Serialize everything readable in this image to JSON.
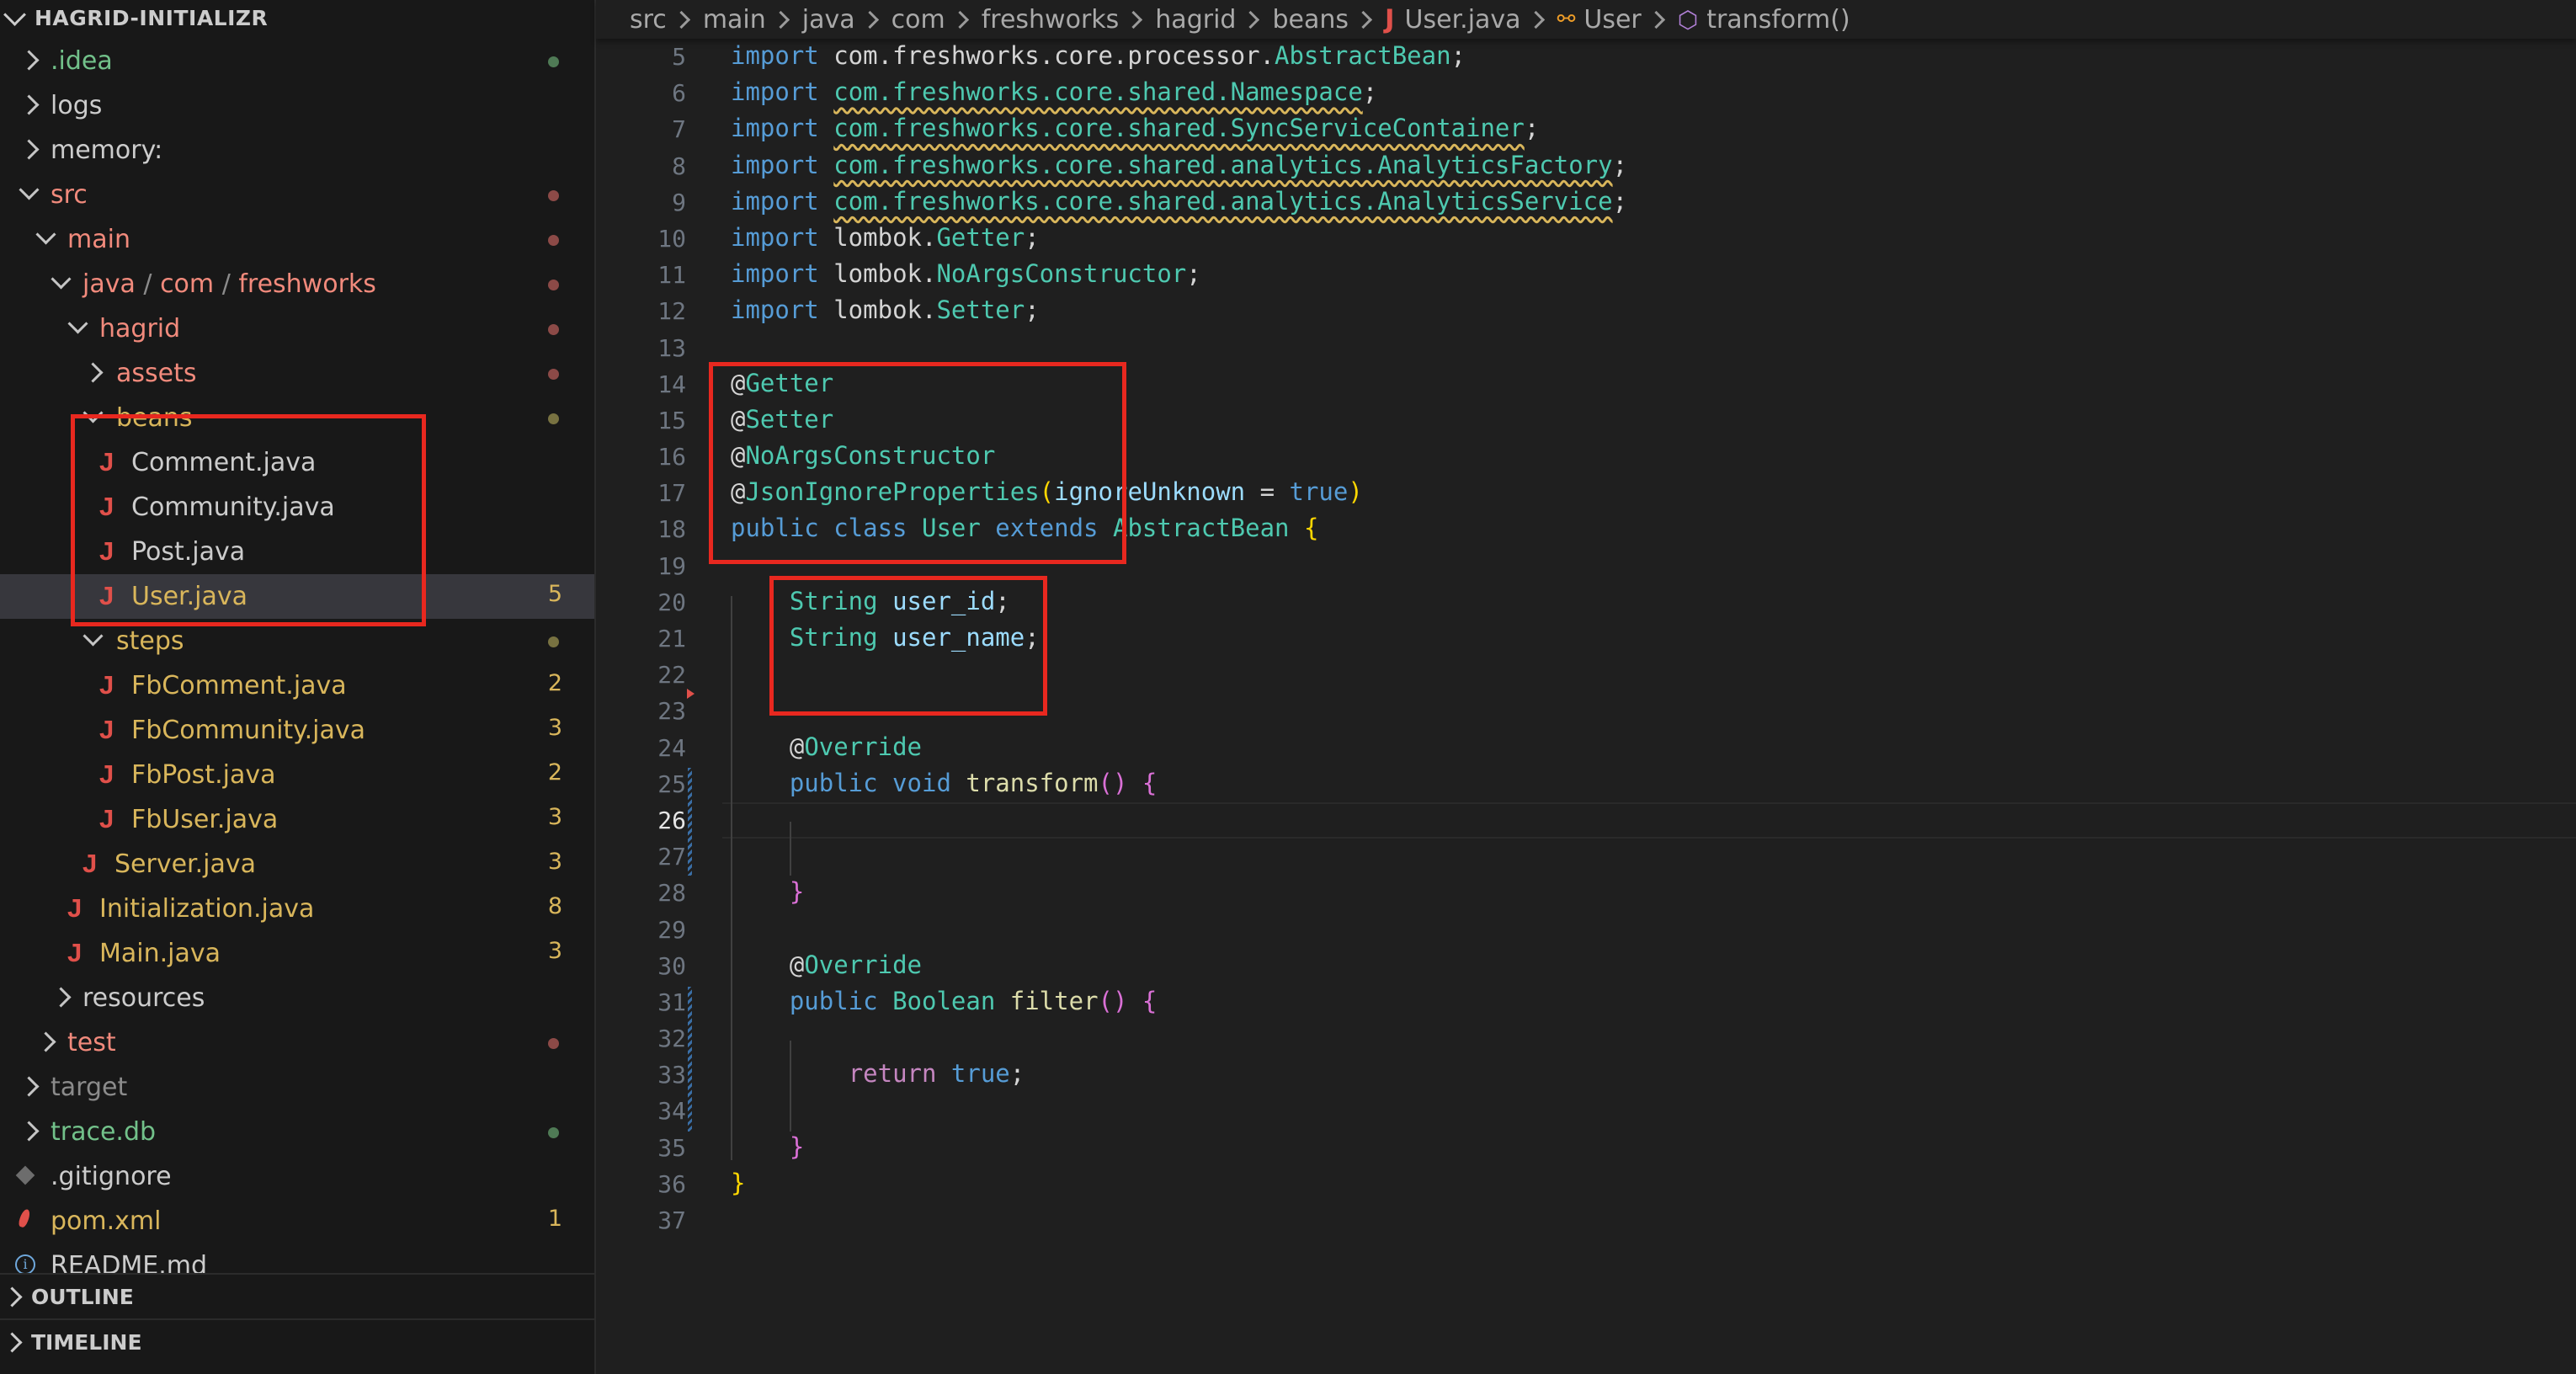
{
  "explorer": {
    "title": "HAGRID-INITIALIZR",
    "rows": [
      {
        "label": ".idea",
        "decor": "dot-green"
      },
      {
        "label": "logs"
      },
      {
        "label": "memory:"
      },
      {
        "label": "src",
        "decor": "dot-red"
      },
      {
        "label": "main",
        "decor": "dot-red"
      },
      {
        "label": "java",
        "label2": "com",
        "label3": "freshworks",
        "decor": "dot-red"
      },
      {
        "label": "hagrid",
        "decor": "dot-red"
      },
      {
        "label": "assets",
        "decor": "dot-red"
      },
      {
        "label": "beans",
        "decor": "dot-yellow"
      },
      {
        "label": "Comment.java"
      },
      {
        "label": "Community.java"
      },
      {
        "label": "Post.java"
      },
      {
        "label": "User.java",
        "count": "5"
      },
      {
        "label": "steps",
        "decor": "dot-yellow"
      },
      {
        "label": "FbComment.java",
        "count": "2"
      },
      {
        "label": "FbCommunity.java",
        "count": "3"
      },
      {
        "label": "FbPost.java",
        "count": "2"
      },
      {
        "label": "FbUser.java",
        "count": "3"
      },
      {
        "label": "Server.java",
        "count": "3"
      },
      {
        "label": "Initialization.java",
        "count": "8"
      },
      {
        "label": "Main.java",
        "count": "3"
      },
      {
        "label": "resources"
      },
      {
        "label": "test",
        "decor": "dot-red"
      },
      {
        "label": "target"
      },
      {
        "label": "trace.db",
        "decor": "dot-green"
      },
      {
        "label": ".gitignore"
      },
      {
        "label": "pom.xml",
        "count": "1"
      },
      {
        "label": "README.md"
      }
    ],
    "path_separator": "/",
    "colors": {
      "modified": "#d9b65b",
      "error": "#f18a7c",
      "untracked": "#72c18a",
      "ignored": "#8b8b8b",
      "java_icon": "#e0504a",
      "dot_red": "#8c4a47",
      "dot_green": "#4f7a55",
      "dot_yellow": "#787241"
    }
  },
  "panels": {
    "outline": "OUTLINE",
    "timeline": "TIMELINE"
  },
  "breadcrumb": {
    "items": [
      "src",
      "main",
      "java",
      "com",
      "freshworks",
      "hagrid",
      "beans",
      "User.java",
      "User",
      "transform()"
    ]
  },
  "editor": {
    "lines": [
      {
        "n": "5",
        "t": [
          [
            "kw",
            "import"
          ],
          [
            "pl",
            " com.freshworks.core.processor."
          ],
          [
            "ty",
            "AbstractBean"
          ],
          [
            "pl",
            ";"
          ]
        ]
      },
      {
        "n": "6",
        "t": [
          [
            "kw",
            "import"
          ],
          [
            "pl",
            " "
          ],
          [
            "ty sq",
            "com.freshworks.core.shared.Namespace"
          ],
          [
            "pl",
            ";"
          ]
        ]
      },
      {
        "n": "7",
        "t": [
          [
            "kw",
            "import"
          ],
          [
            "pl",
            " "
          ],
          [
            "ty sq",
            "com.freshworks.core.shared.SyncServiceContainer"
          ],
          [
            "pl",
            ";"
          ]
        ]
      },
      {
        "n": "8",
        "t": [
          [
            "kw",
            "import"
          ],
          [
            "pl",
            " "
          ],
          [
            "ty sq",
            "com.freshworks.core.shared.analytics.AnalyticsFactory"
          ],
          [
            "pl",
            ";"
          ]
        ]
      },
      {
        "n": "9",
        "t": [
          [
            "kw",
            "import"
          ],
          [
            "pl",
            " "
          ],
          [
            "ty sq",
            "com.freshworks.core.shared.analytics.AnalyticsService"
          ],
          [
            "pl",
            ";"
          ]
        ]
      },
      {
        "n": "10",
        "t": [
          [
            "kw",
            "import"
          ],
          [
            "pl",
            " lombok."
          ],
          [
            "ty",
            "Getter"
          ],
          [
            "pl",
            ";"
          ]
        ]
      },
      {
        "n": "11",
        "t": [
          [
            "kw",
            "import"
          ],
          [
            "pl",
            " lombok."
          ],
          [
            "ty",
            "NoArgsConstructor"
          ],
          [
            "pl",
            ";"
          ]
        ]
      },
      {
        "n": "12",
        "t": [
          [
            "kw",
            "import"
          ],
          [
            "pl",
            " lombok."
          ],
          [
            "ty",
            "Setter"
          ],
          [
            "pl",
            ";"
          ]
        ]
      },
      {
        "n": "13",
        "t": []
      },
      {
        "n": "14",
        "t": [
          [
            "pl",
            "@"
          ],
          [
            "ty",
            "Getter"
          ]
        ]
      },
      {
        "n": "15",
        "t": [
          [
            "pl",
            "@"
          ],
          [
            "ty",
            "Setter"
          ]
        ]
      },
      {
        "n": "16",
        "t": [
          [
            "pl",
            "@"
          ],
          [
            "ty",
            "NoArgsConstructor"
          ]
        ]
      },
      {
        "n": "17",
        "t": [
          [
            "pl",
            "@"
          ],
          [
            "ty",
            "JsonIgnoreProperties"
          ],
          [
            "br1",
            "("
          ],
          [
            "vr",
            "ignoreUnknown"
          ],
          [
            "pl",
            " = "
          ],
          [
            "kw",
            "true"
          ],
          [
            "br1",
            ")"
          ]
        ]
      },
      {
        "n": "18",
        "t": [
          [
            "kw",
            "public class"
          ],
          [
            "pl",
            " "
          ],
          [
            "ty",
            "User"
          ],
          [
            "pl",
            " "
          ],
          [
            "kw",
            "extends"
          ],
          [
            "pl",
            " "
          ],
          [
            "ty",
            "AbstractBean"
          ],
          [
            "pl",
            " "
          ],
          [
            "br1",
            "{"
          ]
        ]
      },
      {
        "n": "19",
        "t": []
      },
      {
        "n": "20",
        "t": [
          [
            "pl",
            "    "
          ],
          [
            "ty",
            "String"
          ],
          [
            "pl",
            " "
          ],
          [
            "vr",
            "user_id"
          ],
          [
            "pl",
            ";"
          ]
        ]
      },
      {
        "n": "21",
        "t": [
          [
            "pl",
            "    "
          ],
          [
            "ty",
            "String"
          ],
          [
            "pl",
            " "
          ],
          [
            "vr",
            "user_name"
          ],
          [
            "pl",
            ";"
          ]
        ]
      },
      {
        "n": "22",
        "t": []
      },
      {
        "n": "23",
        "t": []
      },
      {
        "n": "24",
        "t": [
          [
            "pl",
            "    @"
          ],
          [
            "ty",
            "Override"
          ]
        ]
      },
      {
        "n": "25",
        "t": [
          [
            "pl",
            "    "
          ],
          [
            "kw",
            "public void"
          ],
          [
            "pl",
            " "
          ],
          [
            "fn",
            "transform"
          ],
          [
            "br2",
            "()"
          ],
          [
            "pl",
            " "
          ],
          [
            "br2",
            "{"
          ]
        ]
      },
      {
        "n": "26",
        "t": []
      },
      {
        "n": "27",
        "t": []
      },
      {
        "n": "28",
        "t": [
          [
            "pl",
            "    "
          ],
          [
            "br2",
            "}"
          ]
        ]
      },
      {
        "n": "29",
        "t": []
      },
      {
        "n": "30",
        "t": [
          [
            "pl",
            "    @"
          ],
          [
            "ty",
            "Override"
          ]
        ]
      },
      {
        "n": "31",
        "t": [
          [
            "pl",
            "    "
          ],
          [
            "kw",
            "public"
          ],
          [
            "pl",
            " "
          ],
          [
            "ty",
            "Boolean"
          ],
          [
            "pl",
            " "
          ],
          [
            "fn",
            "filter"
          ],
          [
            "br2",
            "()"
          ],
          [
            "pl",
            " "
          ],
          [
            "br2",
            "{"
          ]
        ]
      },
      {
        "n": "32",
        "t": []
      },
      {
        "n": "33",
        "t": [
          [
            "pl",
            "        "
          ],
          [
            "ctrl",
            "return"
          ],
          [
            "pl",
            " "
          ],
          [
            "kw",
            "true"
          ],
          [
            "pl",
            ";"
          ]
        ]
      },
      {
        "n": "34",
        "t": []
      },
      {
        "n": "35",
        "t": [
          [
            "pl",
            "    "
          ],
          [
            "br2",
            "}"
          ]
        ]
      },
      {
        "n": "36",
        "t": [
          [
            "br1",
            "}"
          ]
        ]
      },
      {
        "n": "37",
        "t": []
      }
    ],
    "active_line": "26",
    "colors": {
      "keyword": "#569cd6",
      "type": "#4ec9b0",
      "function": "#dcdcaa",
      "variable": "#9cdcfe",
      "highlight_box": "#e8281f"
    }
  }
}
